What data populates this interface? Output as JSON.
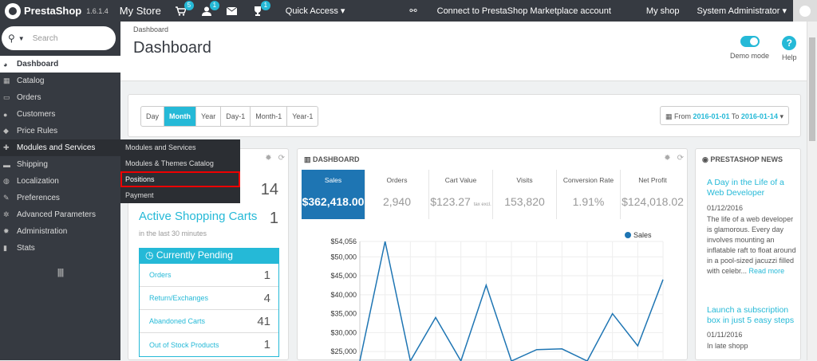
{
  "topbar": {
    "brand": "PrestaShop",
    "version": "1.6.1.4",
    "store": "My Store",
    "badges": {
      "cart": "5",
      "user": "1",
      "trophy": "1"
    },
    "quick_access": "Quick Access ▾",
    "marketplace": "Connect to PrestaShop Marketplace account",
    "myshop": "My shop",
    "admin": "System Administrator ▾"
  },
  "sidebar": {
    "search_placeholder": "Search",
    "items": [
      {
        "label": "Dashboard",
        "icon": "dashboard-icon"
      },
      {
        "label": "Catalog",
        "icon": "catalog-icon"
      },
      {
        "label": "Orders",
        "icon": "orders-icon"
      },
      {
        "label": "Customers",
        "icon": "customers-icon"
      },
      {
        "label": "Price Rules",
        "icon": "tag-icon"
      },
      {
        "label": "Modules and Services",
        "icon": "puzzle-icon"
      },
      {
        "label": "Shipping",
        "icon": "truck-icon"
      },
      {
        "label": "Localization",
        "icon": "globe-icon"
      },
      {
        "label": "Preferences",
        "icon": "wrench-icon"
      },
      {
        "label": "Advanced Parameters",
        "icon": "cogs-icon"
      },
      {
        "label": "Administration",
        "icon": "gear-icon"
      },
      {
        "label": "Stats",
        "icon": "stats-icon"
      }
    ],
    "collapse": "||||"
  },
  "submenu": [
    "Modules and Services",
    "Modules & Themes Catalog",
    "Positions",
    "Payment"
  ],
  "header": {
    "breadcrumb": "Dashboard",
    "title": "Dashboard",
    "demo_mode": "Demo mode",
    "help": "Help",
    "help_glyph": "?"
  },
  "filters": {
    "periods": [
      "Day",
      "Month",
      "Year",
      "Day-1",
      "Month-1",
      "Year-1"
    ],
    "active": "Month",
    "from_label": "From",
    "from": "2016-01-01",
    "to_label": "To",
    "to": "2016-01-14"
  },
  "activity": {
    "visitors_count": "14",
    "carts_title": "Active Shopping Carts",
    "carts_count": "1",
    "carts_sub": "in the last 30 minutes",
    "pending_title": "Currently Pending",
    "pending": [
      {
        "label": "Orders",
        "value": "1"
      },
      {
        "label": "Return/Exchanges",
        "value": "4"
      },
      {
        "label": "Abandoned Carts",
        "value": "41"
      },
      {
        "label": "Out of Stock Products",
        "value": "1"
      }
    ]
  },
  "dashboard": {
    "title": "DASHBOARD",
    "kpis": [
      {
        "label": "Sales",
        "value": "$362,418.00"
      },
      {
        "label": "Orders",
        "value": "2,940"
      },
      {
        "label": "Cart Value",
        "value": "$123.27",
        "suffix": "tax excl."
      },
      {
        "label": "Visits",
        "value": "153,820"
      },
      {
        "label": "Conversion Rate",
        "value": "1.91%"
      },
      {
        "label": "Net Profit",
        "value": "$124,018.02"
      }
    ]
  },
  "news": {
    "title": "PRESTASHOP NEWS",
    "items": [
      {
        "title": "A Day in the Life of a Web Developer",
        "date": "01/12/2016",
        "body": "The life of a web developer is glamorous. Every day involves mounting an inflatable raft to float around in a pool-sized jacuzzi filled with celebr...",
        "more": "Read more"
      },
      {
        "title": "Launch a subscription box in just 5 easy steps",
        "date": "01/11/2016",
        "body": "In late shopp"
      }
    ]
  },
  "chart_data": {
    "type": "line",
    "series": [
      {
        "name": "Sales",
        "color": "#1e75b3",
        "values": [
          22500,
          54056,
          22500,
          34000,
          22500,
          42500,
          22500,
          25500,
          25700,
          22500,
          35000,
          26500,
          44000
        ]
      }
    ],
    "y_ticks": [
      "$54,056",
      "$50,000",
      "$45,000",
      "$40,000",
      "$35,000",
      "$30,000",
      "$25,000"
    ],
    "ylim": [
      22500,
      54056
    ],
    "grid": true,
    "legend": "top-right"
  }
}
